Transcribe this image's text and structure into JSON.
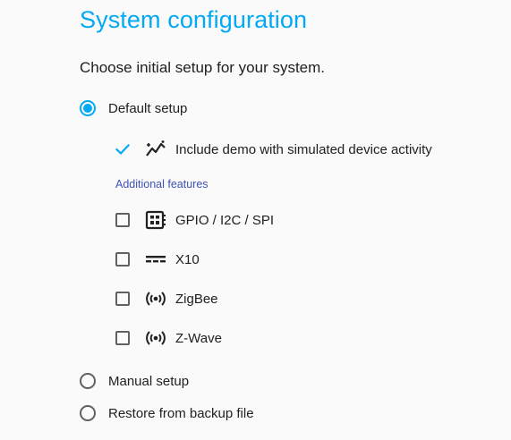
{
  "title": "System configuration",
  "subtitle": "Choose initial setup for your system.",
  "options": {
    "default_setup": {
      "label": "Default setup",
      "selected": true
    },
    "manual_setup": {
      "label": "Manual setup",
      "selected": false
    },
    "restore_backup": {
      "label": "Restore from backup file",
      "selected": false
    }
  },
  "demo": {
    "label": "Include demo with simulated device activity",
    "checked": true,
    "icon": "chart-line-sparkle-icon"
  },
  "additional_features_label": "Additional features",
  "features": [
    {
      "label": "GPIO / I2C / SPI",
      "checked": false,
      "icon": "chip-icon"
    },
    {
      "label": "X10",
      "checked": false,
      "icon": "dc-current-icon"
    },
    {
      "label": "ZigBee",
      "checked": false,
      "icon": "radio-tower-icon"
    },
    {
      "label": "Z-Wave",
      "checked": false,
      "icon": "radio-tower-icon"
    }
  ],
  "colors": {
    "accent": "#03a9f4",
    "section": "#3f51b5",
    "text": "#212121"
  }
}
